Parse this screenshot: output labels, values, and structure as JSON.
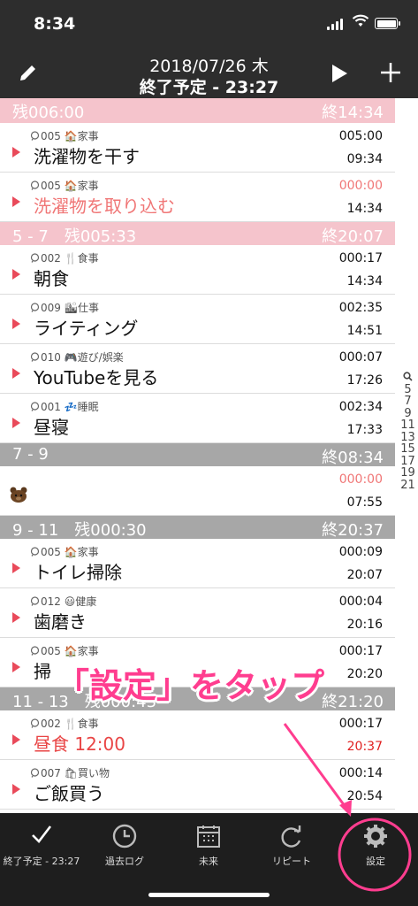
{
  "status": {
    "time": "8:34"
  },
  "header": {
    "date": "2018/07/26 木",
    "end": "終了予定 - 23:27"
  },
  "top_section": {
    "left": "残006:00",
    "right": "終14:34"
  },
  "sections": [
    {
      "kind": "plain",
      "rows": [
        {
          "meta": "005 🏠家事",
          "title": "洗濯物を干す",
          "title_style": "",
          "dur": "005:00",
          "dur_style": "",
          "fin": "09:34",
          "fin_style": ""
        },
        {
          "meta": "005 🏠家事",
          "title": "洗濯物を取り込む",
          "title_style": "pinktext",
          "dur": "000:00",
          "dur_style": "red",
          "fin": "14:34",
          "fin_style": ""
        }
      ]
    },
    {
      "kind": "pink",
      "left": "5 - 7　残005:33",
      "right": "終20:07",
      "rows": [
        {
          "meta": "002 🍴食事",
          "title": "朝食",
          "title_style": "",
          "dur": "000:17",
          "dur_style": "",
          "fin": "14:34",
          "fin_style": ""
        },
        {
          "meta": "009 🏙仕事",
          "title": "ライティング",
          "title_style": "",
          "dur": "002:35",
          "dur_style": "",
          "fin": "14:51",
          "fin_style": ""
        },
        {
          "meta": "010 🎮遊び/娯楽",
          "title": "YouTubeを見る",
          "title_style": "",
          "dur": "000:07",
          "dur_style": "",
          "fin": "17:26",
          "fin_style": ""
        },
        {
          "meta": "001 💤睡眠",
          "title": "昼寝",
          "title_style": "",
          "dur": "002:34",
          "dur_style": "",
          "fin": "17:33",
          "fin_style": ""
        }
      ]
    },
    {
      "kind": "gray",
      "left": "7 - 9",
      "right": "終08:34",
      "rows": [
        {
          "meta": "",
          "title": "",
          "title_style": "",
          "dur": "000:00",
          "dur_style": "red",
          "fin": "07:55",
          "fin_style": "",
          "bear": true
        }
      ]
    },
    {
      "kind": "gray",
      "left": "9 - 11　残000:30",
      "right": "終20:37",
      "rows": [
        {
          "meta": "005 🏠家事",
          "title": "トイレ掃除",
          "title_style": "",
          "dur": "000:09",
          "dur_style": "",
          "fin": "20:07",
          "fin_style": ""
        },
        {
          "meta": "012 😃健康",
          "title": "歯磨き",
          "title_style": "",
          "dur": "000:04",
          "dur_style": "",
          "fin": "20:16",
          "fin_style": ""
        },
        {
          "meta": "005 🏠家事",
          "title": "掃",
          "title_style": "",
          "dur": "000:17",
          "dur_style": "",
          "fin": "20:20",
          "fin_style": ""
        }
      ]
    },
    {
      "kind": "gray",
      "left": "11 - 13　残000:43",
      "right": "終21:20",
      "rows": [
        {
          "meta": "002 🍴食事",
          "title": "昼食 12:00",
          "title_style": "red",
          "dur": "000:17",
          "dur_style": "",
          "fin": "20:37",
          "fin_style": "red"
        },
        {
          "meta": "007 🛍買い物",
          "title": "ご飯買う",
          "title_style": "",
          "dur": "000:14",
          "dur_style": "",
          "fin": "20:54",
          "fin_style": ""
        }
      ]
    }
  ],
  "index": [
    "5",
    "7",
    "9",
    "11",
    "13",
    "15",
    "17",
    "19",
    "21"
  ],
  "tabs": [
    {
      "label": "終了予定 - 23:27",
      "icon": "checkmark-icon"
    },
    {
      "label": "過去ログ",
      "icon": "clock-icon"
    },
    {
      "label": "未来",
      "icon": "calendar-icon"
    },
    {
      "label": "リピート",
      "icon": "repeat-icon"
    },
    {
      "label": "設定",
      "icon": "gear-icon"
    }
  ],
  "annotation": {
    "text": "「設定」をタップ",
    "color": "#ff3d8f"
  },
  "colors": {
    "accent": "#e94a5a",
    "pink_section": "#f5c4cc",
    "gray_section": "#a7a7a7",
    "header": "#2d2d2d"
  }
}
